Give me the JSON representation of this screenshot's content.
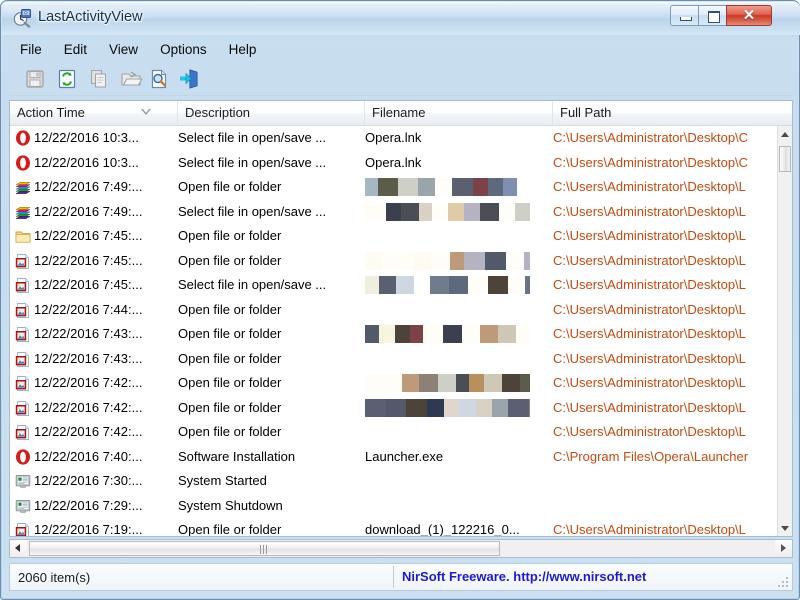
{
  "window": {
    "title": "LastActivityView",
    "app_icon": "clock-magnifier-icon",
    "buttons": {
      "minimize": "minimize-button",
      "maximize": "maximize-button",
      "close": "✕"
    },
    "colors": {
      "titlebar_top": "#eaf3fb",
      "titlebar_bottom": "#d8e9f7",
      "close_button": "#c63a26",
      "path_text": "#c24a10",
      "brand_text": "#1c1ccc",
      "frame_border": "#6b8fae"
    }
  },
  "menubar": {
    "items": [
      {
        "label": "File"
      },
      {
        "label": "Edit"
      },
      {
        "label": "View"
      },
      {
        "label": "Options"
      },
      {
        "label": "Help"
      }
    ]
  },
  "toolbar": {
    "buttons": [
      {
        "name": "save-icon",
        "enabled": false
      },
      {
        "name": "refresh-icon",
        "enabled": true
      },
      {
        "name": "copy-icon",
        "enabled": false
      },
      {
        "name": "open-folder-icon",
        "enabled": false
      },
      {
        "name": "properties-icon",
        "enabled": true
      },
      {
        "name": "exit-icon",
        "enabled": true
      }
    ]
  },
  "listview": {
    "columns": [
      {
        "label": "Action Time",
        "sorted": true,
        "sort_direction": "descending"
      },
      {
        "label": "Description",
        "sorted": false
      },
      {
        "label": "Filename",
        "sorted": false
      },
      {
        "label": "Full Path",
        "sorted": false
      }
    ],
    "rows": [
      {
        "icon": "opera-icon",
        "time": "12/22/2016 10:3...",
        "description": "Select file in open/save ...",
        "filename": "Opera.lnk",
        "filename_redacted": false,
        "path": "C:\\Users\\Administrator\\Desktop\\C"
      },
      {
        "icon": "opera-icon",
        "time": "12/22/2016 10:3...",
        "description": "Select file in open/save ...",
        "filename": "Opera.lnk",
        "filename_redacted": false,
        "path": "C:\\Users\\Administrator\\Desktop\\C"
      },
      {
        "icon": "winrar-icon",
        "time": "12/22/2016 7:49:...",
        "description": "Open file or folder",
        "filename": "",
        "filename_redacted": true,
        "path": "C:\\Users\\Administrator\\Desktop\\L"
      },
      {
        "icon": "winrar-icon",
        "time": "12/22/2016 7:49:...",
        "description": "Select file in open/save ...",
        "filename": "",
        "filename_redacted": true,
        "path": "C:\\Users\\Administrator\\Desktop\\L"
      },
      {
        "icon": "folder-icon",
        "time": "12/22/2016 7:45:...",
        "description": "Open file or folder",
        "filename": "",
        "filename_redacted": false,
        "path": "C:\\Users\\Administrator\\Desktop\\L"
      },
      {
        "icon": "image-file-icon",
        "time": "12/22/2016 7:45:...",
        "description": "Open file or folder",
        "filename": "",
        "filename_redacted": true,
        "path": "C:\\Users\\Administrator\\Desktop\\L"
      },
      {
        "icon": "image-file-icon",
        "time": "12/22/2016 7:45:...",
        "description": "Select file in open/save ...",
        "filename": "",
        "filename_redacted": true,
        "path": "C:\\Users\\Administrator\\Desktop\\L"
      },
      {
        "icon": "image-file-icon",
        "time": "12/22/2016 7:44:...",
        "description": "Open file or folder",
        "filename": "",
        "filename_redacted": false,
        "path": "C:\\Users\\Administrator\\Desktop\\L"
      },
      {
        "icon": "image-file-icon",
        "time": "12/22/2016 7:43:...",
        "description": "Open file or folder",
        "filename": "",
        "filename_redacted": true,
        "path": "C:\\Users\\Administrator\\Desktop\\L"
      },
      {
        "icon": "image-file-icon",
        "time": "12/22/2016 7:43:...",
        "description": "Open file or folder",
        "filename": "",
        "filename_redacted": false,
        "path": "C:\\Users\\Administrator\\Desktop\\L"
      },
      {
        "icon": "image-file-icon",
        "time": "12/22/2016 7:42:...",
        "description": "Open file or folder",
        "filename": "",
        "filename_redacted": true,
        "path": "C:\\Users\\Administrator\\Desktop\\L"
      },
      {
        "icon": "image-file-icon",
        "time": "12/22/2016 7:42:...",
        "description": "Open file or folder",
        "filename": "",
        "filename_redacted": true,
        "path": "C:\\Users\\Administrator\\Desktop\\L"
      },
      {
        "icon": "image-file-icon",
        "time": "12/22/2016 7:42:...",
        "description": "Open file or folder",
        "filename": "",
        "filename_redacted": false,
        "path": "C:\\Users\\Administrator\\Desktop\\L"
      },
      {
        "icon": "opera-icon",
        "time": "12/22/2016 7:40:...",
        "description": "Software Installation",
        "filename": "Launcher.exe",
        "filename_redacted": false,
        "path": "C:\\Program Files\\Opera\\Launcher"
      },
      {
        "icon": "monitor-icon",
        "time": "12/22/2016 7:30:...",
        "description": "System Started",
        "filename": "",
        "filename_redacted": false,
        "path": ""
      },
      {
        "icon": "monitor-icon",
        "time": "12/22/2016 7:29:...",
        "description": "System Shutdown",
        "filename": "",
        "filename_redacted": false,
        "path": ""
      },
      {
        "icon": "image-file-icon",
        "time": "12/22/2016 7:19:...",
        "description": "Open file or folder",
        "filename": "download_(1)_122216_0...",
        "filename_redacted": false,
        "path": "C:\\Users\\Administrator\\Desktop\\L"
      }
    ]
  },
  "statusbar": {
    "count": "2060 item(s)",
    "brand": "NirSoft Freeware.  http://www.nirsoft.net"
  }
}
